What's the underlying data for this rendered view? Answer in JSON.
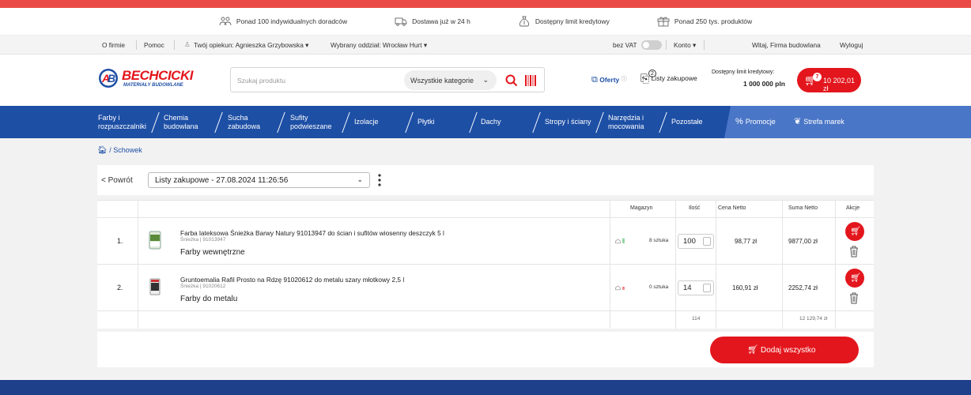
{
  "promo_bar": [
    {
      "label": "Ponad 100 indywidualnych doradców",
      "icon": "advisors-icon"
    },
    {
      "label": "Dostawa już w 24 h",
      "icon": "truck-icon"
    },
    {
      "label": "Dostępny limit kredytowy",
      "icon": "money-bag-icon"
    },
    {
      "label": "Ponad 250 tys. produktów",
      "icon": "gift-icon"
    }
  ],
  "util_bar": {
    "about": "O firmie",
    "help": "Pomoc",
    "caretaker": "Twój opiekun: Agnieszka Grzybowska",
    "branch": "Wybrany oddział: Wrocław Hurt",
    "vat": "bez VAT",
    "account": "Konto",
    "welcome": "Witaj, Firma budowlana",
    "logout": "Wyloguj"
  },
  "header": {
    "logo_text": "BECHCICKI",
    "logo_sub": "MATERIAŁY BUDOWLANE",
    "search_placeholder": "Szukaj produktu",
    "category_select": "Wszystkie kategorie",
    "offers": "Oferty",
    "lists_badge": "2",
    "lists": "Listy zakupowe",
    "credit_label": "Dostępny limit kredytowy:",
    "credit_value": "1 000 000 pln",
    "cart_count": "7",
    "cart_total": "10 202,01 zł"
  },
  "nav": [
    {
      "line1": "Farby i",
      "line2": "rozpuszczalniki"
    },
    {
      "line1": "Chemia",
      "line2": "budowlana"
    },
    {
      "line1": "Sucha",
      "line2": "zabudowa"
    },
    {
      "line1": "Sufity",
      "line2": "podwieszane"
    },
    {
      "line1": "Izolacje",
      "line2": ""
    },
    {
      "line1": "Płytki",
      "line2": ""
    },
    {
      "line1": "Dachy",
      "line2": ""
    },
    {
      "line1": "Stropy i ściany",
      "line2": ""
    },
    {
      "line1": "Narzędzia i",
      "line2": "mocowania"
    },
    {
      "line1": "Pozostałe",
      "line2": ""
    }
  ],
  "nav_promo": {
    "promotions": "Promocje",
    "brands": "Strefa marek"
  },
  "breadcrumb": {
    "sep": "/",
    "current": "Schowek"
  },
  "list_panel": {
    "back": "< Powrót",
    "selected_list": "Listy zakupowe - 27.08.2024 11:26:56"
  },
  "table": {
    "headers": {
      "warehouse": "Magazyn",
      "qty": "Ilość",
      "net_price": "Cena Netto",
      "net_sum": "Suma Netto",
      "actions": "Akcje"
    },
    "rows": [
      {
        "num": "1.",
        "name": "Farba lateksowa Śnieżka Barwy Natury 91013947 do ścian i sufitów wiosenny deszczyk 5 l",
        "sub": "Śnieżka | 91013947",
        "category": "Farby wewnętrzne",
        "stock": "8 sztuka",
        "stock_color": "#27a84a",
        "qty": "100",
        "price": "98,77 zł",
        "sum": "9877,00 zł"
      },
      {
        "num": "2.",
        "name": "Gruntoemalia Rafil Prosto na Rdzę 91020612 do metalu szary młotkowy 2,5 l",
        "sub": "Śnieżka | 91020612",
        "category": "Farby do metalu",
        "stock": "0 sztuka",
        "stock_color": "#e3161d",
        "qty": "14",
        "price": "160,91 zł",
        "sum": "2252,74 zł"
      }
    ],
    "total_qty": "114",
    "total_sum": "12 129,74 zł"
  },
  "add_all": "Dodaj wszystko",
  "colors": {
    "brand_blue": "#1d4fa5",
    "brand_red": "#e3161d",
    "top_red": "#e94a45"
  }
}
